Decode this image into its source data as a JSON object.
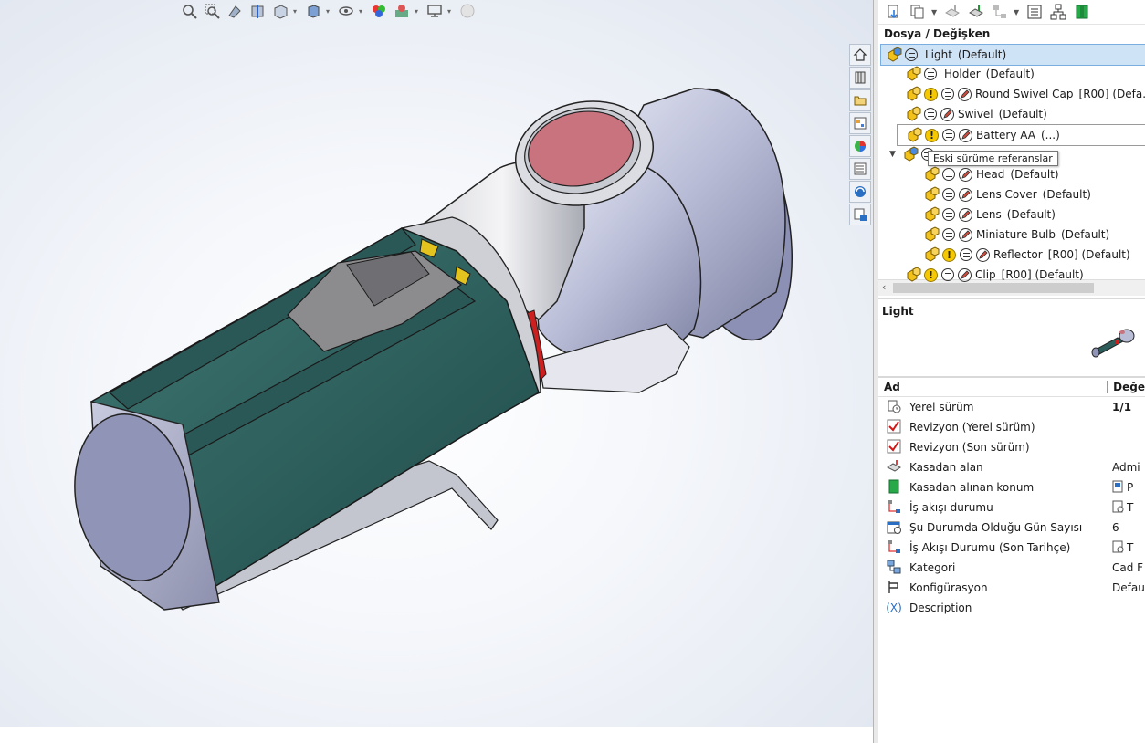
{
  "tree": {
    "header": "Dosya / Değişken",
    "tooltip": "Eski sürüme referanslar",
    "items": [
      {
        "name": "Light",
        "config": "(Default)"
      },
      {
        "name": "Holder",
        "config": "(Default)"
      },
      {
        "name": "Round Swivel Cap",
        "config": "[R00]  (Defa..."
      },
      {
        "name": "Swivel",
        "config": "(Default)"
      },
      {
        "name": "Battery AA",
        "config": "(...)"
      },
      {
        "name": "",
        "config": ""
      },
      {
        "name": "Head",
        "config": "(Default)"
      },
      {
        "name": "Lens Cover",
        "config": "(Default)"
      },
      {
        "name": "Lens",
        "config": "(Default)"
      },
      {
        "name": "Miniature Bulb",
        "config": "(Default)"
      },
      {
        "name": "Reflector",
        "config": "[R00]  (Default)"
      },
      {
        "name": "Clip",
        "config": "[R00]  (Default)"
      }
    ]
  },
  "preview": {
    "title": "Light"
  },
  "variables": {
    "col_name": "Ad",
    "col_value": "Değe",
    "rows": [
      {
        "name": "Yerel sürüm",
        "value": "1/1",
        "icon": "local-version-icon"
      },
      {
        "name": "Revizyon (Yerel sürüm)",
        "value": "",
        "icon": "check-icon"
      },
      {
        "name": "Revizyon (Son sürüm)",
        "value": "",
        "icon": "check-icon"
      },
      {
        "name": "Kasadan alan",
        "value": "Admi",
        "icon": "checkout-user-icon"
      },
      {
        "name": "Kasadan alınan konum",
        "value": "P",
        "icon": "checkout-location-icon"
      },
      {
        "name": "İş akışı durumu",
        "value": "T",
        "icon": "workflow-icon"
      },
      {
        "name": "Şu Durumda Olduğu Gün Sayısı",
        "value": "6",
        "icon": "calendar-icon"
      },
      {
        "name": "İş Akışı Durumu (Son Tarihçe)",
        "value": "T",
        "icon": "workflow-icon"
      },
      {
        "name": "Kategori",
        "value": "Cad F",
        "icon": "category-icon"
      },
      {
        "name": "Konfigürasyon",
        "value": "Defau",
        "icon": "configuration-icon"
      },
      {
        "name": "Description",
        "value": "",
        "icon": "variable-x-icon"
      }
    ],
    "description_glyph": "(X)"
  },
  "colors": {
    "selection": "#cfe3f7",
    "battery_body": "#2c5d5a",
    "head_shell": "#b9bdd6",
    "lens": "#c9737f",
    "accent_red": "#cc1f1f"
  }
}
